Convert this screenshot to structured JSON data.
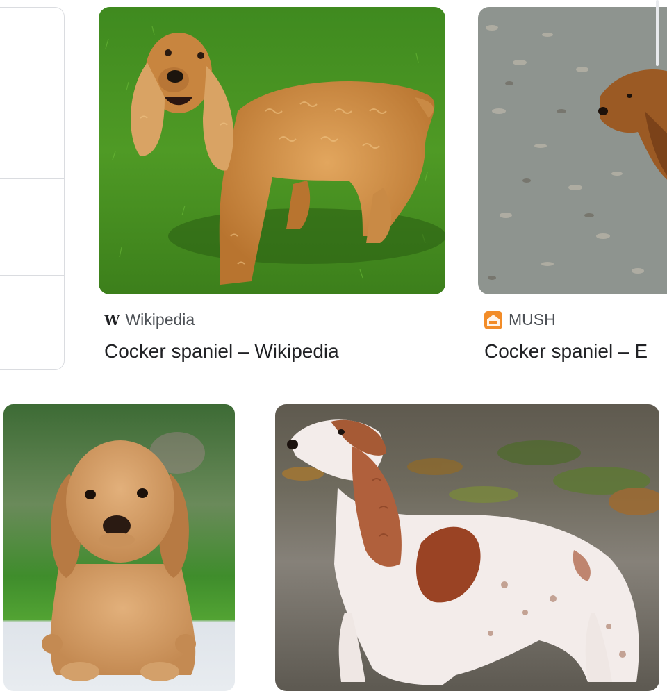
{
  "results": [
    {
      "source": "Wikipedia",
      "source_icon": "wikipedia-w-icon",
      "title": "Cocker spaniel – Wikipedia",
      "image": "golden-cocker-spaniel-on-grass"
    },
    {
      "source": "MUSH",
      "source_icon": "mush-logo-icon",
      "title": "Cocker spaniel – E",
      "image": "cocker-spaniel-on-leaves"
    },
    {
      "image": "cocker-spaniel-puppy"
    },
    {
      "image": "white-brown-cocker-spaniel"
    }
  ],
  "colors": {
    "source_text": "#4d5156",
    "title_text": "#202124",
    "card_border": "#dadce0",
    "mush_orange": "#f28c28"
  }
}
